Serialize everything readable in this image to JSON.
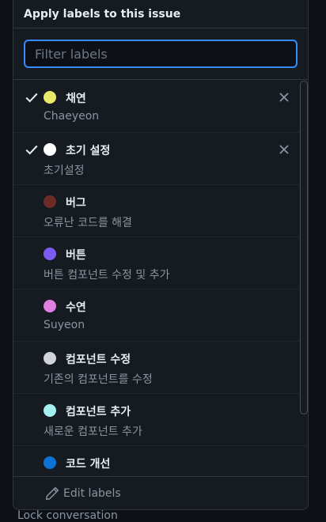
{
  "header": {
    "title": "Apply labels to this issue"
  },
  "filter": {
    "placeholder": "Filter labels",
    "value": ""
  },
  "labels": [
    {
      "name": "채연",
      "description": "Chaeyeon",
      "color": "#e8e86a",
      "checked": true
    },
    {
      "name": "초기 설정",
      "description": "초기설정",
      "color": "#ffffff",
      "checked": true
    },
    {
      "name": "버그",
      "description": "오류난 코드를 해결",
      "color": "#6e2a27",
      "checked": false
    },
    {
      "name": "버튼",
      "description": "버튼 컴포넌트 수정 및 추가",
      "color": "#7c5cf0",
      "checked": false
    },
    {
      "name": "수연",
      "description": "Suyeon",
      "color": "#df7fe0",
      "checked": false
    },
    {
      "name": "컴포넌트 수정",
      "description": "기존의 컴포넌트를 수정",
      "color": "#d0d3d8",
      "checked": false
    },
    {
      "name": "컴포넌트 추가",
      "description": "새로운 컴포넌트 추가",
      "color": "#a4efef",
      "checked": false
    },
    {
      "name": "코드 개선",
      "description": "",
      "color": "#0b74d6",
      "checked": false
    }
  ],
  "footer": {
    "edit_label": "Edit labels"
  },
  "background": {
    "lock_text": "Lock conversation"
  }
}
